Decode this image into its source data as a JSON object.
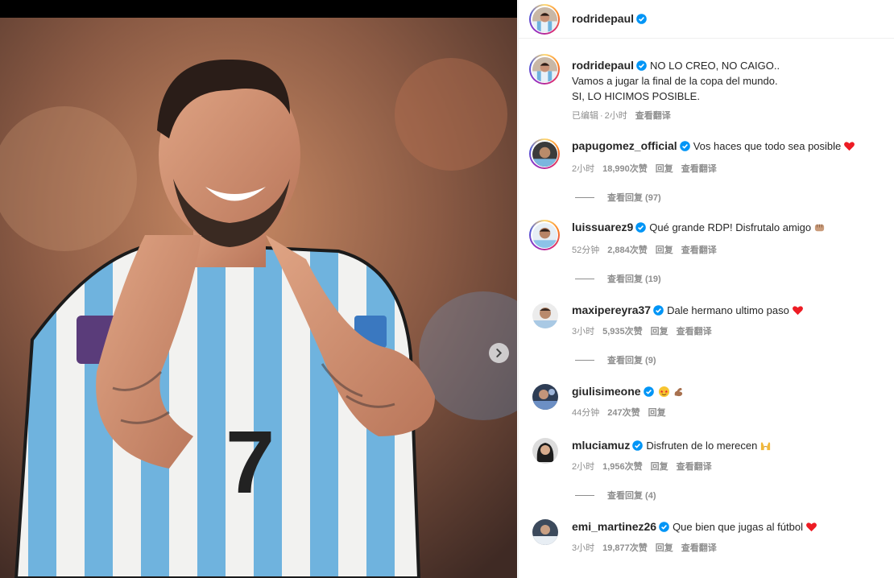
{
  "post": {
    "username": "rodridepaul",
    "caption_lines": [
      "NO LO CREO, NO CAIGO..",
      "Vamos a jugar la final de la copa del mundo.",
      "SI, LO HICIMOS POSIBLE."
    ],
    "edited_label": "已编辑",
    "time": "2小时",
    "translate_label": "查看翻译"
  },
  "colors": {
    "verified": "#0095f6",
    "secondary_text": "#8e8e8e",
    "heart": "#ed1c24"
  },
  "labels": {
    "reply": "回复",
    "translate": "查看翻译"
  },
  "comments": [
    {
      "username": "papugomez_official",
      "text": "Vos haces que todo sea posible",
      "emoji": "red-heart",
      "time": "2小时",
      "likes": "18,990次赞",
      "view_replies": "查看回复 (97)"
    },
    {
      "username": "luissuarez9",
      "text": "Qué grande RDP! Disfrutalo amigo",
      "emoji": "fist-bump",
      "time": "52分钟",
      "likes": "2,884次赞",
      "view_replies": "查看回复 (19)"
    },
    {
      "username": "maxipereyra37",
      "text": "Dale hermano ultimo paso",
      "emoji": "red-heart",
      "time": "3小时",
      "likes": "5,935次赞",
      "view_replies": "查看回复 (9)"
    },
    {
      "username": "giulisimeone",
      "text": "",
      "emoji": "star-struck-flexed-biceps",
      "time": "44分钟",
      "likes": "247次赞",
      "view_replies": ""
    },
    {
      "username": "mluciamuz",
      "text": "Disfruten de lo merecen",
      "emoji": "raising-hands",
      "time": "2小时",
      "likes": "1,956次赞",
      "view_replies": "查看回复 (4)"
    },
    {
      "username": "emi_martinez26",
      "text": "Que bien que jugas al fútbol",
      "emoji": "red-heart",
      "time": "3小时",
      "likes": "19,877次赞",
      "view_replies": ""
    }
  ]
}
